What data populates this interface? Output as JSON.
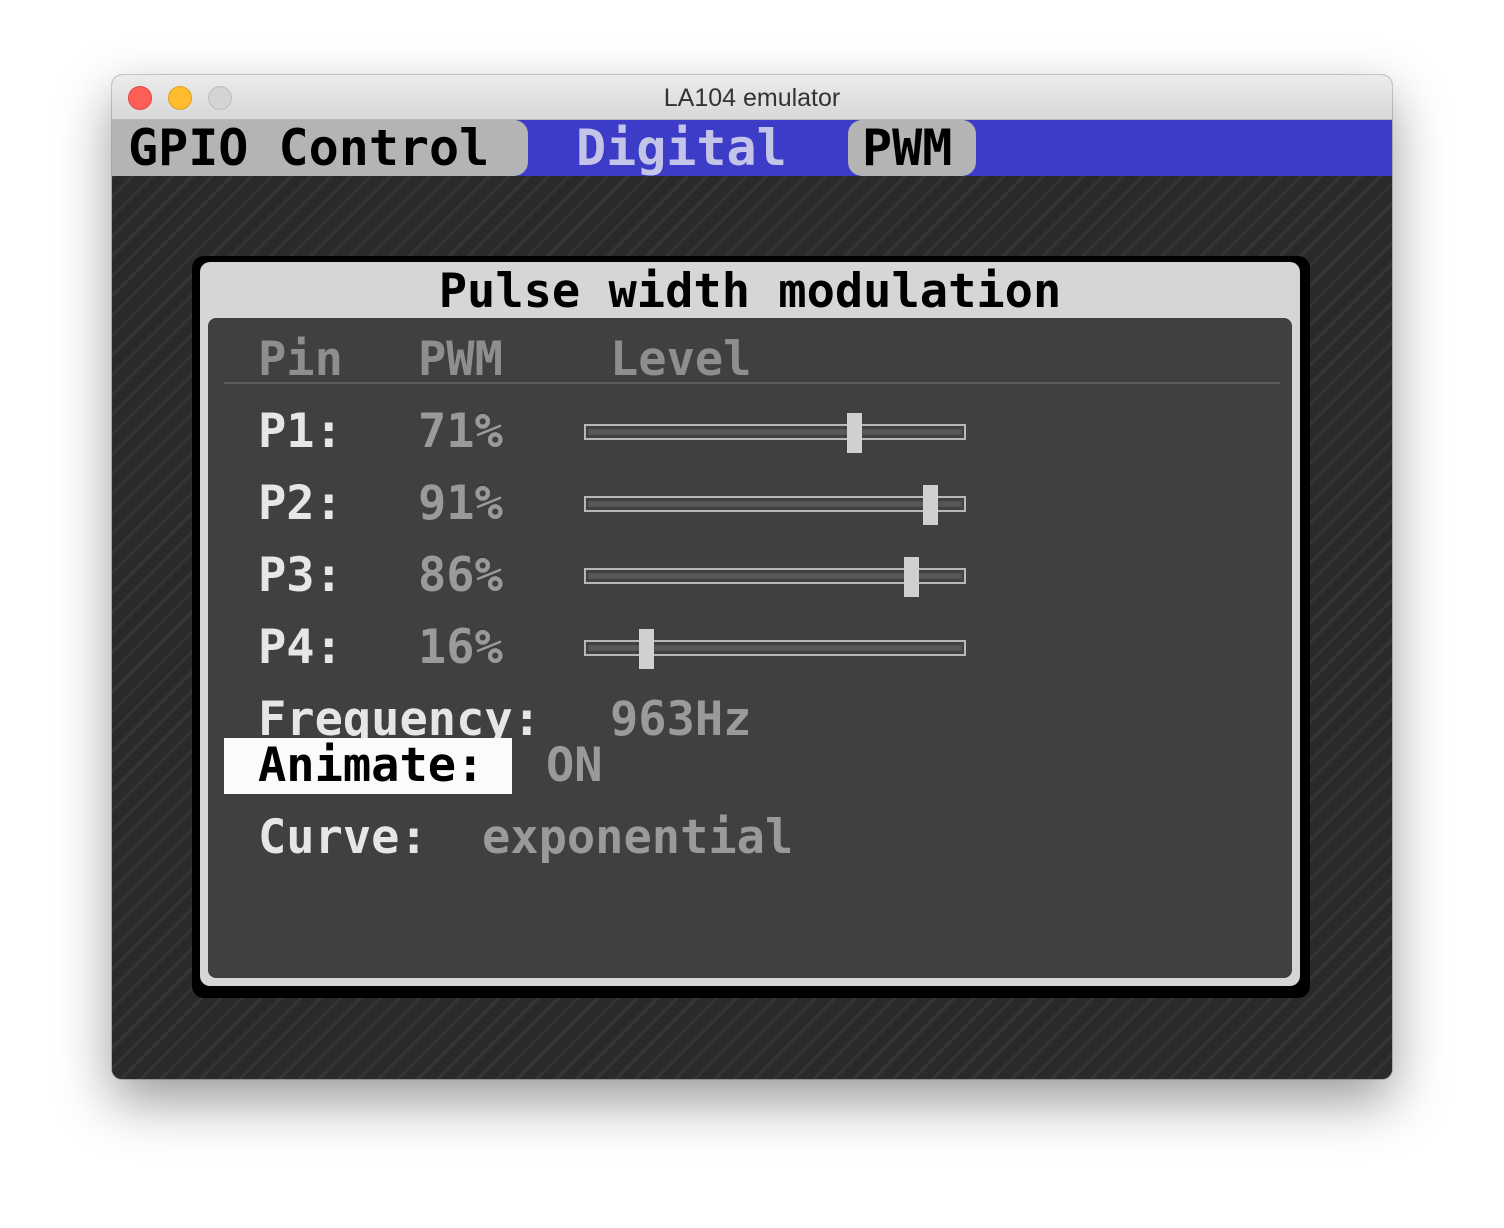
{
  "window": {
    "title": "LA104 emulator"
  },
  "menubar": {
    "app_title": "GPIO Control",
    "tab_digital": "Digital",
    "tab_pwm": "PWM"
  },
  "dialog": {
    "title": "Pulse width modulation",
    "columns": {
      "pin": "Pin",
      "pwm": "PWM",
      "level": "Level"
    },
    "pins": [
      {
        "label": "P1:",
        "pwm": "71%",
        "level": 71
      },
      {
        "label": "P2:",
        "pwm": "91%",
        "level": 91
      },
      {
        "label": "P3:",
        "pwm": "86%",
        "level": 86
      },
      {
        "label": "P4:",
        "pwm": "16%",
        "level": 16
      }
    ],
    "frequency": {
      "label": "Frequency:",
      "value": "963Hz"
    },
    "animate": {
      "label": "Animate:",
      "value": "ON"
    },
    "curve": {
      "label": "Curve:",
      "value": "exponential"
    }
  },
  "colors": {
    "menubar_background": "#3c3cc8",
    "tab_background": "#b4b4b4",
    "panel_background": "#404040",
    "focus_highlight": "#fbfbfb"
  }
}
